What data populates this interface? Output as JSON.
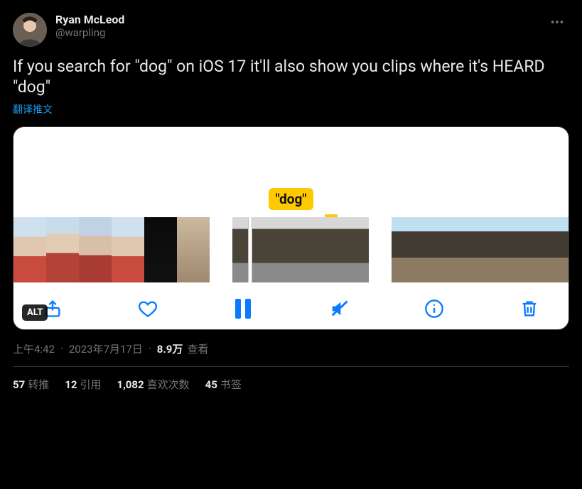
{
  "author": {
    "display_name": "Ryan McLeod",
    "handle": "@warpling"
  },
  "tweet_text": "If you search for \"dog\" on iOS 17 it'll also show you clips where it's HEARD \"dog\"",
  "translate_label": "翻译推文",
  "media": {
    "search_tag": "\"dog\"",
    "alt_badge": "ALT"
  },
  "meta": {
    "time": "上午4:42",
    "date": "2023年7月17日",
    "views_number": "8.9万",
    "views_label": "查看"
  },
  "stats": {
    "retweets_count": "57",
    "retweets_label": "转推",
    "quotes_count": "12",
    "quotes_label": "引用",
    "likes_count": "1,082",
    "likes_label": "喜欢次数",
    "bookmarks_count": "45",
    "bookmarks_label": "书签"
  }
}
